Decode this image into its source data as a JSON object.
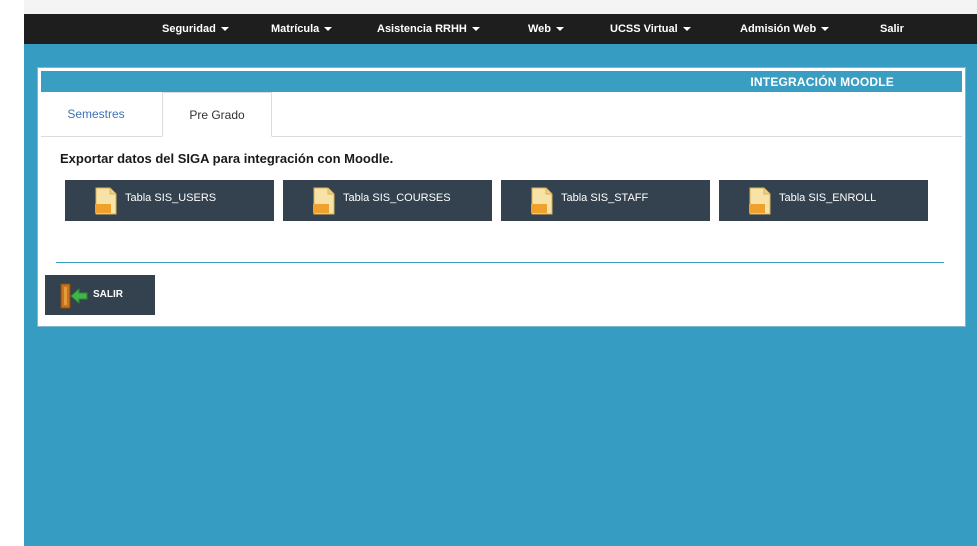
{
  "nav": {
    "items": [
      {
        "label": "Seguridad"
      },
      {
        "label": "Matrícula"
      },
      {
        "label": "Asistencia RRHH"
      },
      {
        "label": "Web"
      },
      {
        "label": "UCSS Virtual"
      },
      {
        "label": "Admisión Web"
      },
      {
        "label": "Salir"
      }
    ]
  },
  "panel": {
    "title": "INTEGRACIÓN MOODLE",
    "tabs": [
      {
        "label": "Semestres"
      },
      {
        "label": "Pre Grado"
      }
    ],
    "heading": "Exportar datos del SIGA para integración con Moodle.",
    "buttons": [
      {
        "label": "Tabla SIS_USERS",
        "icon": "csv-file-icon"
      },
      {
        "label": "Tabla SIS_COURSES",
        "icon": "csv-file-icon"
      },
      {
        "label": "Tabla SIS_STAFF",
        "icon": "csv-file-icon"
      },
      {
        "label": "Tabla SIS_ENROLL",
        "icon": "csv-file-icon"
      }
    ],
    "exit_label": "SALIR"
  },
  "colors": {
    "navbar": "#1e1e1e",
    "background": "#379cc1",
    "panel_header": "#3a9ec2",
    "button": "#33424e",
    "active_tab_text": "#3a73b8"
  }
}
